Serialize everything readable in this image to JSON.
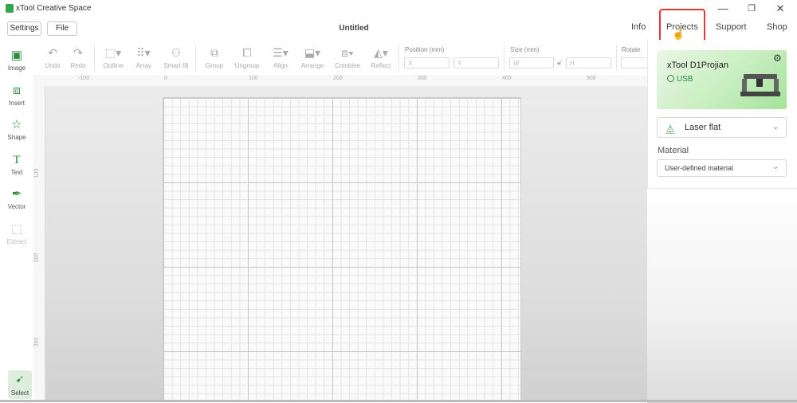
{
  "app": {
    "title": "xTool Creative Space",
    "doc_title": "Untitled"
  },
  "window": {
    "minimize": "—",
    "restore": "❐",
    "close": "✕"
  },
  "menu": {
    "settings": "Settings",
    "file": "File"
  },
  "nav": {
    "info": "Info",
    "projects": "Projects",
    "support": "Support",
    "shop": "Shop"
  },
  "toolbar": {
    "undo": "Undo",
    "redo": "Redo",
    "outline": "Outline",
    "array": "Array",
    "smart_fill": "Smart fill",
    "group": "Group",
    "ungroup": "Ungroup",
    "align": "Align",
    "arrange": "Arrange",
    "combine": "Combine",
    "reflect": "Reflect",
    "position_label": "Position (mm)",
    "x_placeholder": "X",
    "y_placeholder": "Y",
    "size_label": "Size (mm)",
    "w_placeholder": "W",
    "h_placeholder": "H",
    "rotate_label": "Rotate"
  },
  "left_tools": {
    "image": "Image",
    "insert": "Insert",
    "shape": "Shape",
    "text": "Text",
    "vector": "Vector",
    "extract": "Extract",
    "select": "Select"
  },
  "ruler": {
    "h": [
      "-100",
      "0",
      "100",
      "200",
      "300",
      "400",
      "500"
    ],
    "v": [
      "100",
      "200",
      "300"
    ]
  },
  "device": {
    "name": "xTool D1Projian",
    "connection": "USB"
  },
  "processing": {
    "mode": "Laser flat",
    "material_label": "Material",
    "material": "User-defined material"
  },
  "colors": {
    "accent": "#2fa84f",
    "highlight": "#e53935"
  }
}
